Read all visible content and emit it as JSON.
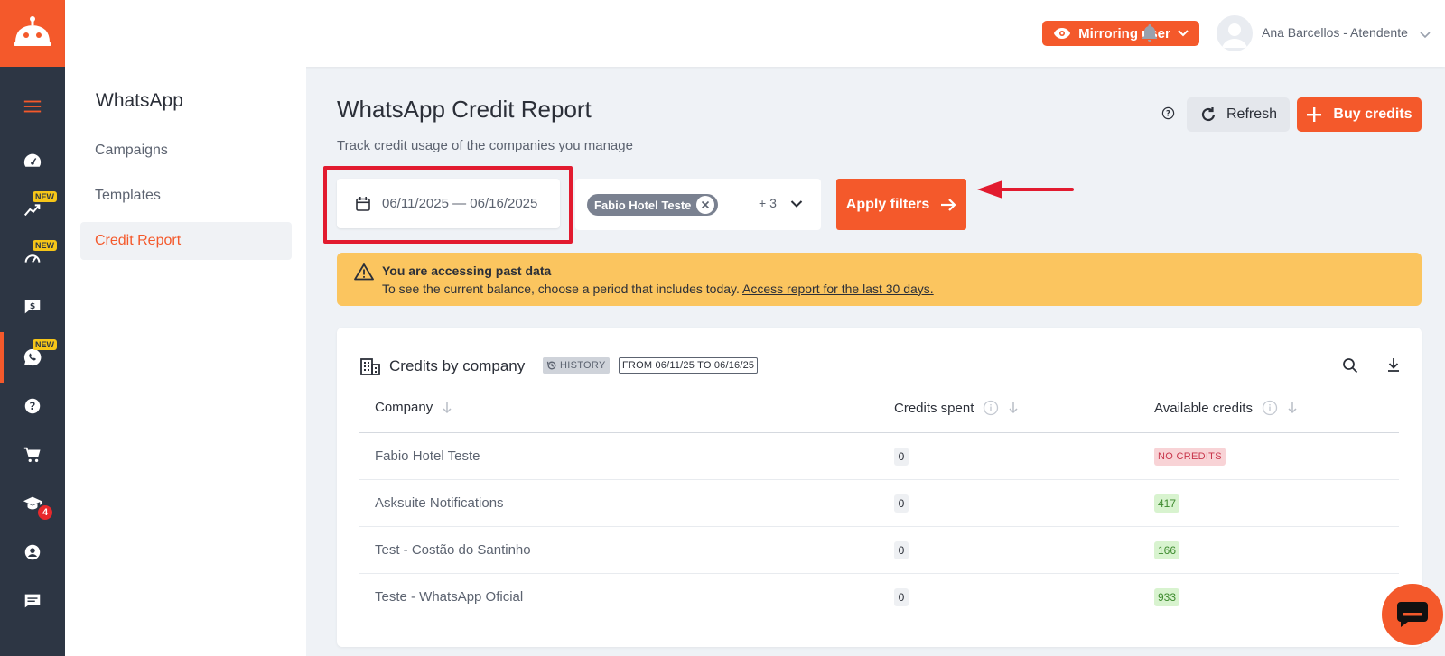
{
  "header": {
    "mirroring_label": "Mirroring user",
    "user_name": "Ana Barcellos - Atendente"
  },
  "rail": {
    "new_badge": "NEW",
    "notification_count": "4"
  },
  "subnav": {
    "title": "WhatsApp",
    "items": [
      {
        "label": "Campaigns"
      },
      {
        "label": "Templates"
      },
      {
        "label": "Credit Report"
      }
    ]
  },
  "page": {
    "title": "WhatsApp Credit Report",
    "subtitle": "Track credit usage of the companies you manage",
    "refresh_label": "Refresh",
    "buy_label": "Buy credits"
  },
  "filters": {
    "date_range": "06/11/2025 — 06/16/2025",
    "selected_company": "Fabio Hotel Teste",
    "more_count": "+ 3",
    "apply_label": "Apply filters"
  },
  "warning": {
    "title": "You are accessing past data",
    "text": "To see the current balance, choose a period that includes today.",
    "link": "Access report for the last 30 days."
  },
  "card": {
    "title": "Credits by company",
    "history_tag": "HISTORY",
    "range_tag": "FROM 06/11/25 TO 06/16/25",
    "columns": [
      "Company",
      "Credits spent",
      "Available credits"
    ],
    "rows": [
      {
        "company": "Fabio Hotel Teste",
        "spent": "0",
        "available": "NO CREDITS",
        "status": "none"
      },
      {
        "company": "Asksuite Notifications",
        "spent": "0",
        "available": "417",
        "status": "ok"
      },
      {
        "company": "Test - Costão do Santinho",
        "spent": "0",
        "available": "166",
        "status": "ok"
      },
      {
        "company": "Teste - WhatsApp Oficial",
        "spent": "0",
        "available": "933",
        "status": "ok"
      }
    ]
  },
  "colors": {
    "brand": "#f4592b",
    "rail": "#2d3644",
    "warning": "#fbc55f",
    "highlight": "#e21b2f"
  }
}
